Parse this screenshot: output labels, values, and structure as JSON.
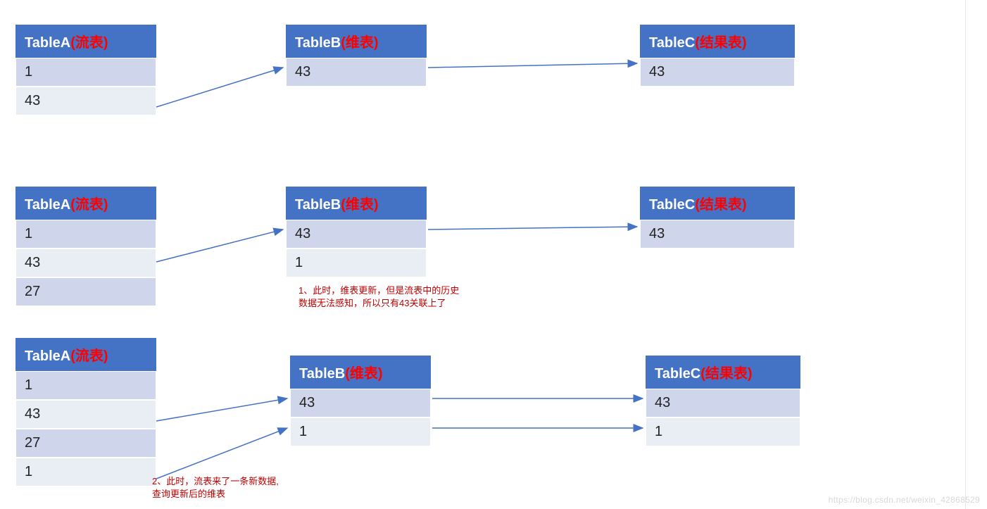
{
  "tables": {
    "a": {
      "prefix": "TableA",
      "suffix": "(流表)"
    },
    "b": {
      "prefix": "TableB",
      "suffix": "(维表)"
    },
    "c": {
      "prefix": "TableC",
      "suffix": "(结果表)"
    }
  },
  "scenes": [
    {
      "a_rows": [
        "1",
        "43"
      ],
      "b_rows": [
        "43"
      ],
      "c_rows": [
        "43"
      ]
    },
    {
      "a_rows": [
        "1",
        "43",
        "27"
      ],
      "b_rows": [
        "43",
        "1"
      ],
      "c_rows": [
        "43"
      ],
      "note_b": "1、此时，维表更新，但是流表中的历史\n数据无法感知，所以只有43关联上了"
    },
    {
      "a_rows": [
        "1",
        "43",
        "27",
        "1"
      ],
      "b_rows": [
        "43",
        "1"
      ],
      "c_rows": [
        "43",
        "1"
      ],
      "note_a": "2、此时，流表来了一条新数据,\n查询更新后的维表"
    }
  ],
  "watermark": "https://blog.csdn.net/weixin_42868529",
  "colors": {
    "header_bg": "#4472c4",
    "cell_dark": "#cfd5ea",
    "cell_light": "#e9edf4",
    "arrow": "#4472c4",
    "note": "#c00000"
  },
  "chart_data": {
    "type": "table",
    "description": "Three stages illustrating stream-table (流表) joining a dimension-table snapshot (维表) producing a result table (结果表).",
    "stages": [
      {
        "stream": [
          1,
          43
        ],
        "dim_snapshot": [
          43
        ],
        "result": [
          43
        ]
      },
      {
        "stream": [
          1,
          43,
          27
        ],
        "dim_snapshot": [
          43,
          1
        ],
        "result": [
          43
        ],
        "note": "维表更新，但流表历史数据无法感知，只有43关联上"
      },
      {
        "stream": [
          1,
          43,
          27,
          1
        ],
        "dim_snapshot": [
          43,
          1
        ],
        "result": [
          43,
          1
        ],
        "note": "流表来了一条新数据，查询更新后的维表"
      }
    ]
  }
}
